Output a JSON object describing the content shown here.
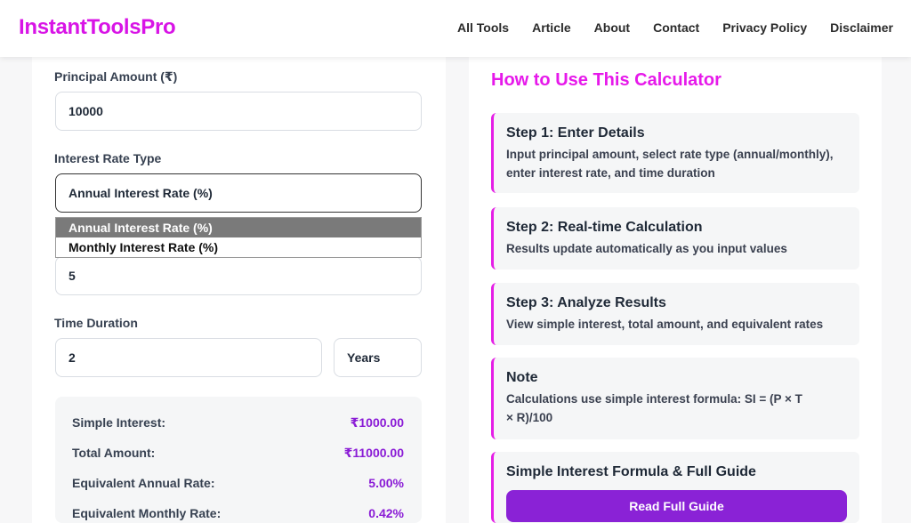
{
  "header": {
    "logo": "InstantToolsPro",
    "nav": [
      "All Tools",
      "Article",
      "About",
      "Contact",
      "Privacy Policy",
      "Disclaimer"
    ]
  },
  "form": {
    "principal_label": "Principal Amount (₹)",
    "principal_value": "10000",
    "rate_type_label": "Interest Rate Type",
    "rate_type_value": "Annual Interest Rate (%)",
    "rate_type_options": [
      "Annual Interest Rate (%)",
      "Monthly Interest Rate (%)"
    ],
    "rate_value": "5",
    "time_label": "Time Duration",
    "time_value": "2",
    "time_unit": "Years"
  },
  "results": [
    {
      "label": "Simple Interest:",
      "value": "₹1000.00"
    },
    {
      "label": "Total Amount:",
      "value": "₹11000.00"
    },
    {
      "label": "Equivalent Annual Rate:",
      "value": "5.00%"
    },
    {
      "label": "Equivalent Monthly Rate:",
      "value": "0.42%"
    }
  ],
  "guide": {
    "title": "How to Use This Calculator",
    "steps": [
      {
        "title": "Step 1: Enter Details",
        "text": "Input principal amount, select rate type (annual/monthly), enter interest rate, and time duration"
      },
      {
        "title": "Step 2: Real-time Calculation",
        "text": "Results update automatically as you input values"
      },
      {
        "title": "Step 3: Analyze Results",
        "text": "View simple interest, total amount, and equivalent rates"
      },
      {
        "title": "Note",
        "text": "Calculations use simple interest formula: SI = (P × T × R)/100"
      },
      {
        "title": "Simple Interest Formula & Full Guide",
        "text": ""
      }
    ],
    "button": "Read Full Guide"
  },
  "colors": {
    "brand": "#d814e6",
    "accent": "#8a22d6"
  }
}
